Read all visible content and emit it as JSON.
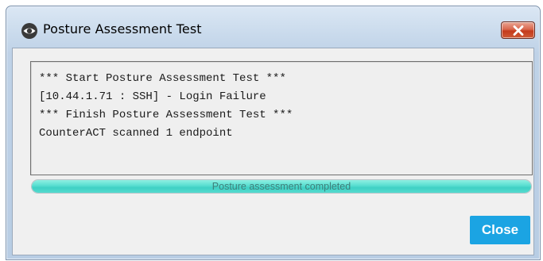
{
  "window": {
    "title": "Posture Assessment Test",
    "icon": "eye-icon",
    "close_icon": "close-x-icon"
  },
  "log": {
    "lines": [
      "*** Start Posture Assessment Test ***",
      "[10.44.1.71 : SSH] - Login Failure",
      "*** Finish Posture Assessment Test ***",
      "CounterACT scanned 1 endpoint"
    ]
  },
  "progress": {
    "label": "Posture assessment completed",
    "fraction": 1.0,
    "fill_color": "#4fd8cb"
  },
  "buttons": {
    "close_label": "Close",
    "accent_color": "#1ba4e3"
  }
}
